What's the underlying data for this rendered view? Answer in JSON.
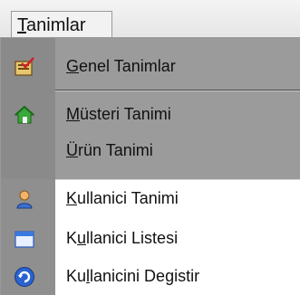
{
  "menubar": {
    "menu_title": "Tanimlar",
    "menu_title_hotkey": "T",
    "menu_title_rest": "animlar"
  },
  "menu": {
    "items": [
      {
        "hotkey": "G",
        "rest": "enel Tanimlar",
        "label": "Genel Tanimlar",
        "icon": "form-check-icon"
      },
      {
        "hotkey": "M",
        "rest": "üsteri Tanimi",
        "label": "Müsteri Tanimi",
        "icon": "house-icon"
      },
      {
        "hotkey": "Ü",
        "rest": "rün Tanimi",
        "label": "Ürün Tanimi",
        "icon": ""
      },
      {
        "hotkey": "K",
        "rest": "ullanici Tanimi",
        "label": "Kullanici Tanimi",
        "icon": "user-icon"
      },
      {
        "hotkey_prefix": "K",
        "hotkey": "u",
        "rest": "llanici Listesi",
        "label": "Kullanici Listesi",
        "icon": "window-icon"
      },
      {
        "hotkey_prefix": "Ku",
        "hotkey": "l",
        "rest": "lanicini Degistir",
        "label": "Kullanicini Degistir",
        "icon": "switch-user-icon"
      }
    ]
  },
  "colors": {
    "highlight": "#8a8a8a",
    "gutter": "#8f8f8f",
    "background": "#ffffff"
  }
}
